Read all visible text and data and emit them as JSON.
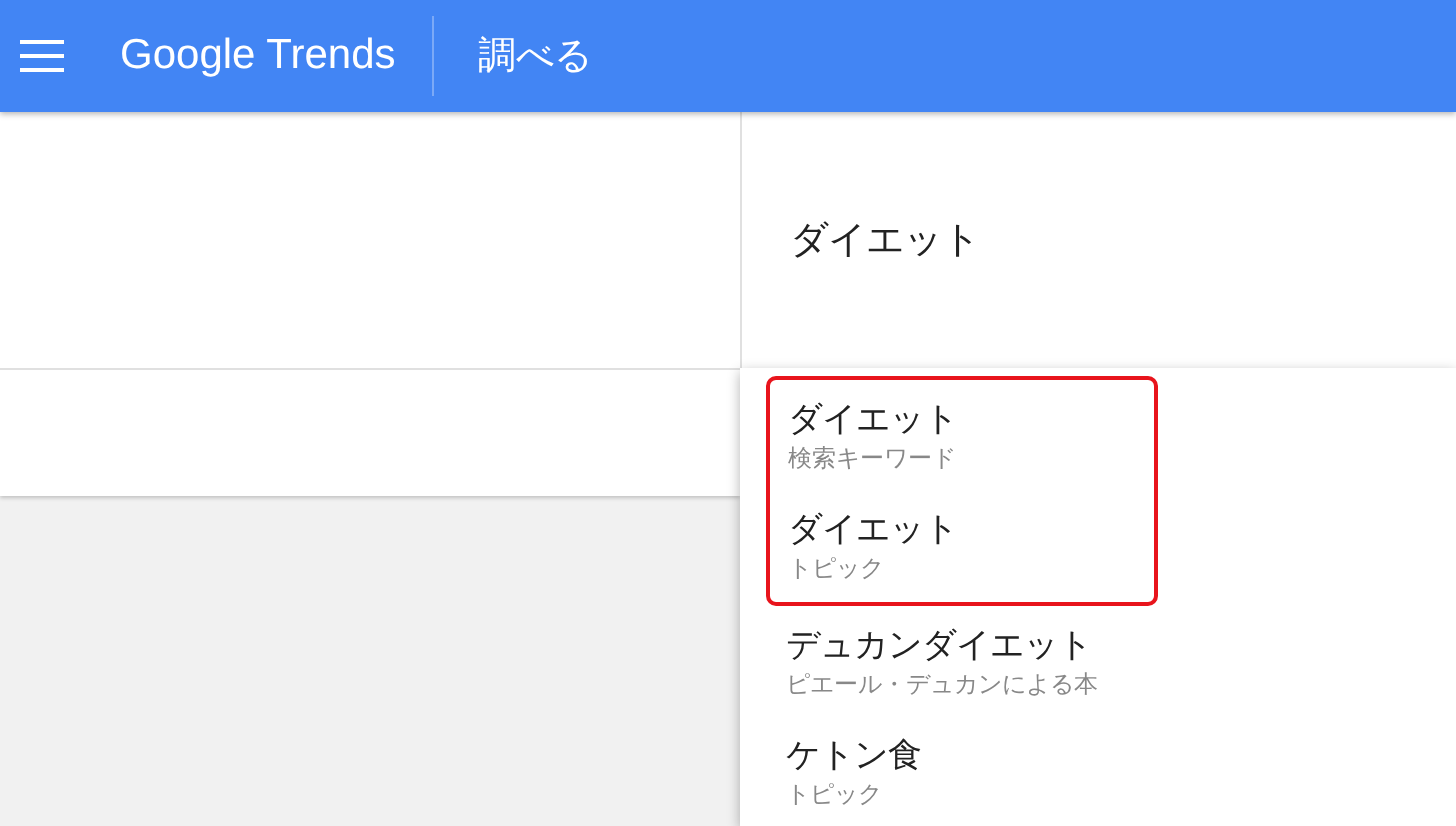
{
  "header": {
    "logo": "Google Trends",
    "title": "調べる"
  },
  "search": {
    "value": "ダイエット"
  },
  "highlighted_suggestions": [
    {
      "title": "ダイエット",
      "subtitle": "検索キーワード"
    },
    {
      "title": "ダイエット",
      "subtitle": "トピック"
    }
  ],
  "suggestions": [
    {
      "title": "デュカンダイエット",
      "subtitle": "ピエール・デュカンによる本"
    },
    {
      "title": "ケトン食",
      "subtitle": "トピック"
    }
  ]
}
